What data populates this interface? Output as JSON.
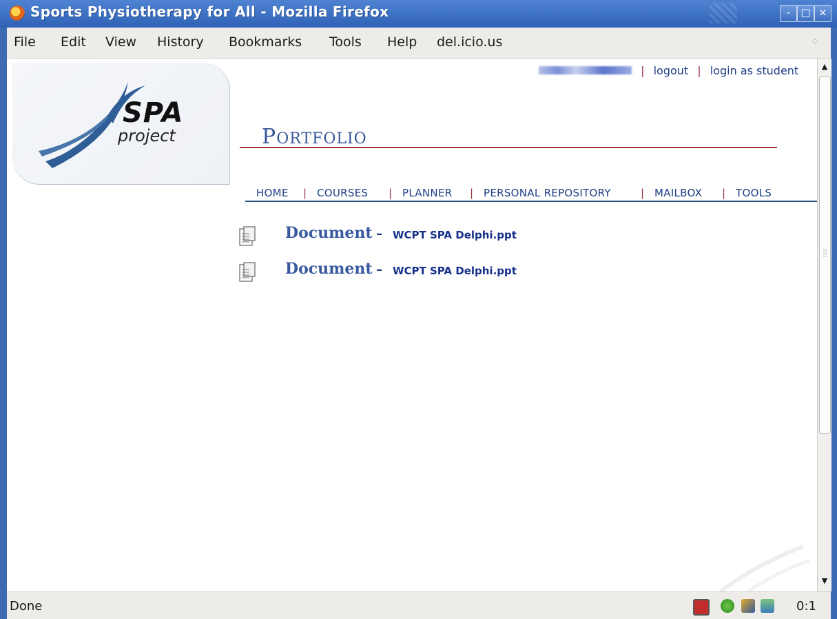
{
  "window": {
    "title": "Sports Physiotherapy for All - Mozilla Firefox",
    "buttons": {
      "minimize": "-",
      "maximize": "□",
      "close": "×"
    }
  },
  "menubar": {
    "items": [
      "File",
      "Edit",
      "View",
      "History",
      "Bookmarks",
      "Tools",
      "Help",
      "del.icio.us"
    ],
    "throbber": "⁘"
  },
  "logo": {
    "line1": "SPA",
    "line2": "project"
  },
  "userbar": {
    "logout": "logout",
    "login_as_student": "login as student",
    "separator": "|"
  },
  "page": {
    "title": {
      "first_letter": "P",
      "rest": "ORTFOLIO"
    }
  },
  "nav": {
    "items": [
      "HOME",
      "COURSES",
      "PLANNER",
      "PERSONAL REPOSITORY",
      "MAILBOX",
      "TOOLS"
    ],
    "separator": "|"
  },
  "documents": [
    {
      "label": "Document",
      "dash": "–",
      "file": "WCPT SPA Delphi.ppt"
    },
    {
      "label": "Document",
      "dash": "–",
      "file": "WCPT SPA Delphi.ppt"
    }
  ],
  "scrollbar": {
    "up": "▲",
    "down": "▼"
  },
  "statusbar": {
    "text": "Done",
    "counter": "0:1"
  },
  "colors": {
    "accent_red": "#9a3042",
    "link_blue": "#1e3e86",
    "title_blue": "#37569a",
    "frame_blue": "#3c6bb4"
  }
}
